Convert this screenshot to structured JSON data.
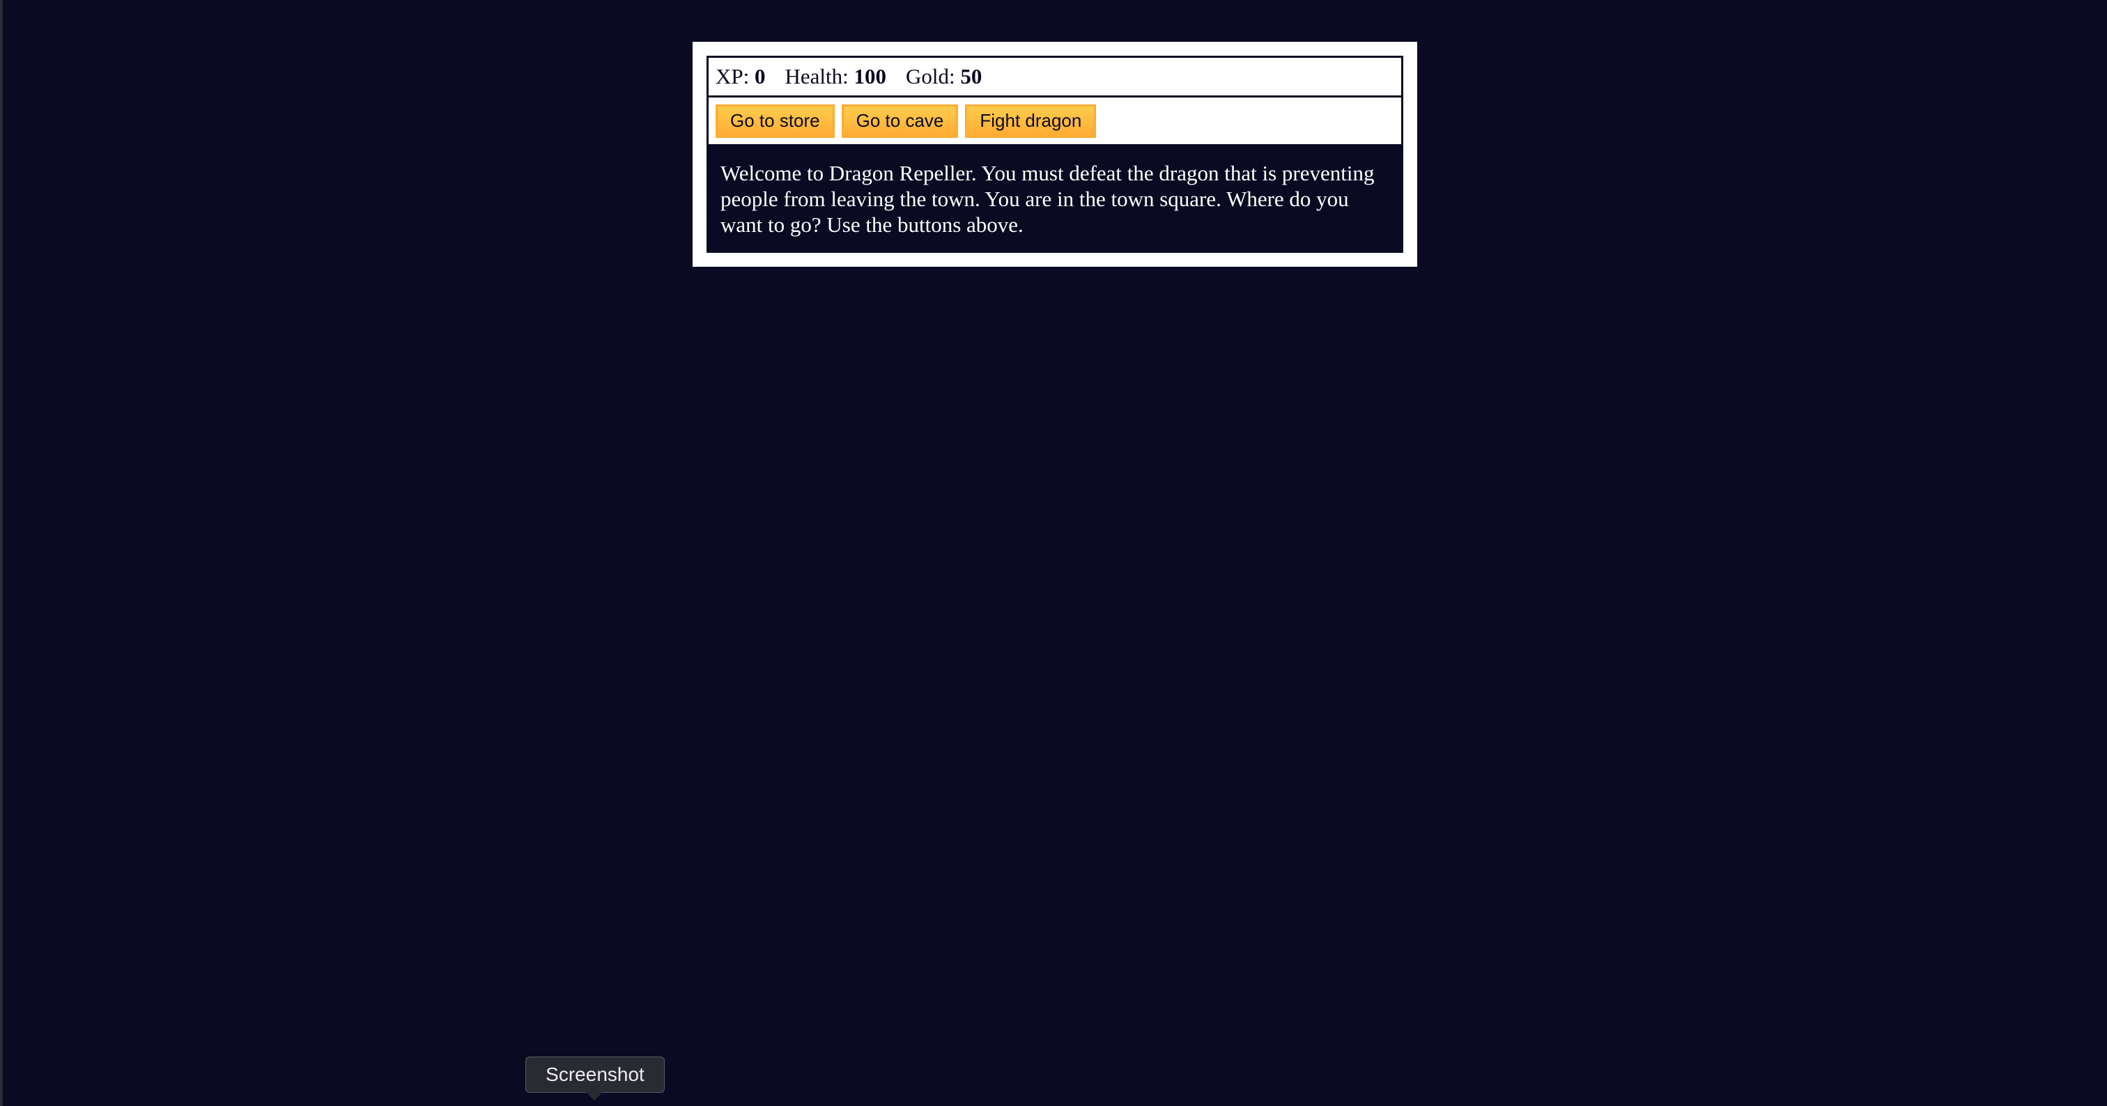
{
  "stats": {
    "xp_label": "XP:",
    "xp_value": "0",
    "health_label": "Health:",
    "health_value": "100",
    "gold_label": "Gold:",
    "gold_value": "50"
  },
  "controls": {
    "button1": "Go to store",
    "button2": "Go to cave",
    "button3": "Fight dragon"
  },
  "text": {
    "message": "Welcome to Dragon Repeller. You must defeat the dragon that is preventing people from leaving the town. You are in the town square. Where do you want to go? Use the buttons above."
  },
  "tooltip": {
    "label": "Screenshot"
  },
  "colors": {
    "background": "#0a0a23",
    "button": "#feac32",
    "panel": "#ffffff"
  }
}
